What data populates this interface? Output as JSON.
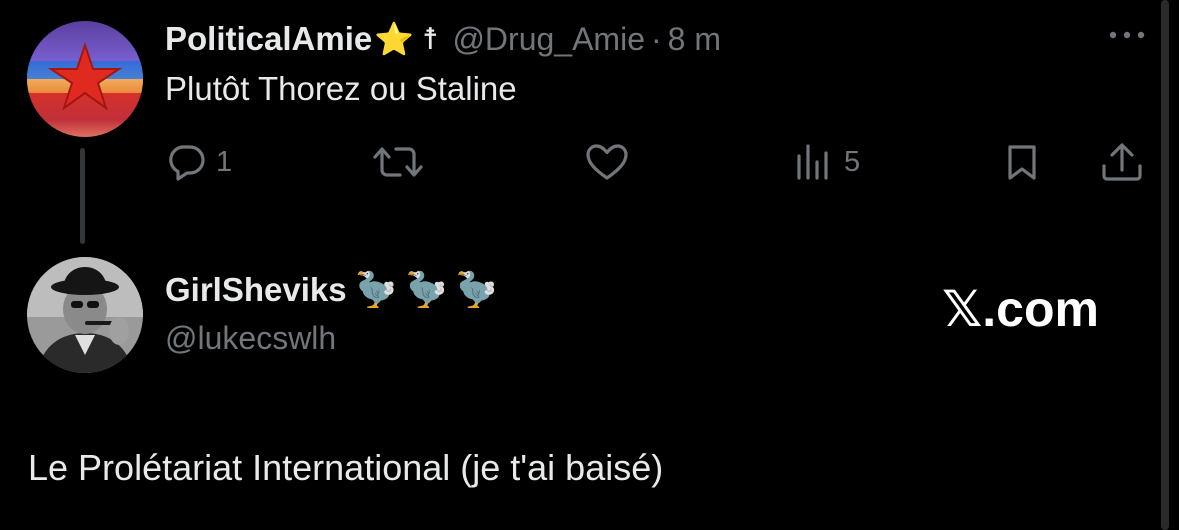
{
  "tweet1": {
    "display_name": "PoliticalAmie",
    "name_emoji": "⭐",
    "name_symbol": "☨",
    "handle": "@Drug_Amie",
    "separator": "·",
    "time": "8 m",
    "text": "Plutôt Thorez ou Staline",
    "actions": {
      "reply_count": "1",
      "retweet_count": "",
      "like_count": "",
      "views_count": "5"
    }
  },
  "tweet2": {
    "display_name": "GirlSheviks",
    "name_emojis": [
      "🦤",
      "🦤",
      "🦤"
    ],
    "handle": "@lukecswlh",
    "text": "Le Prolétariat International (je t'ai baisé)"
  },
  "watermark": "𝕏.com",
  "colors": {
    "background": "#000000",
    "primary_text": "#e7e9ea",
    "secondary_text": "#71767b",
    "thread_line": "#333639"
  }
}
